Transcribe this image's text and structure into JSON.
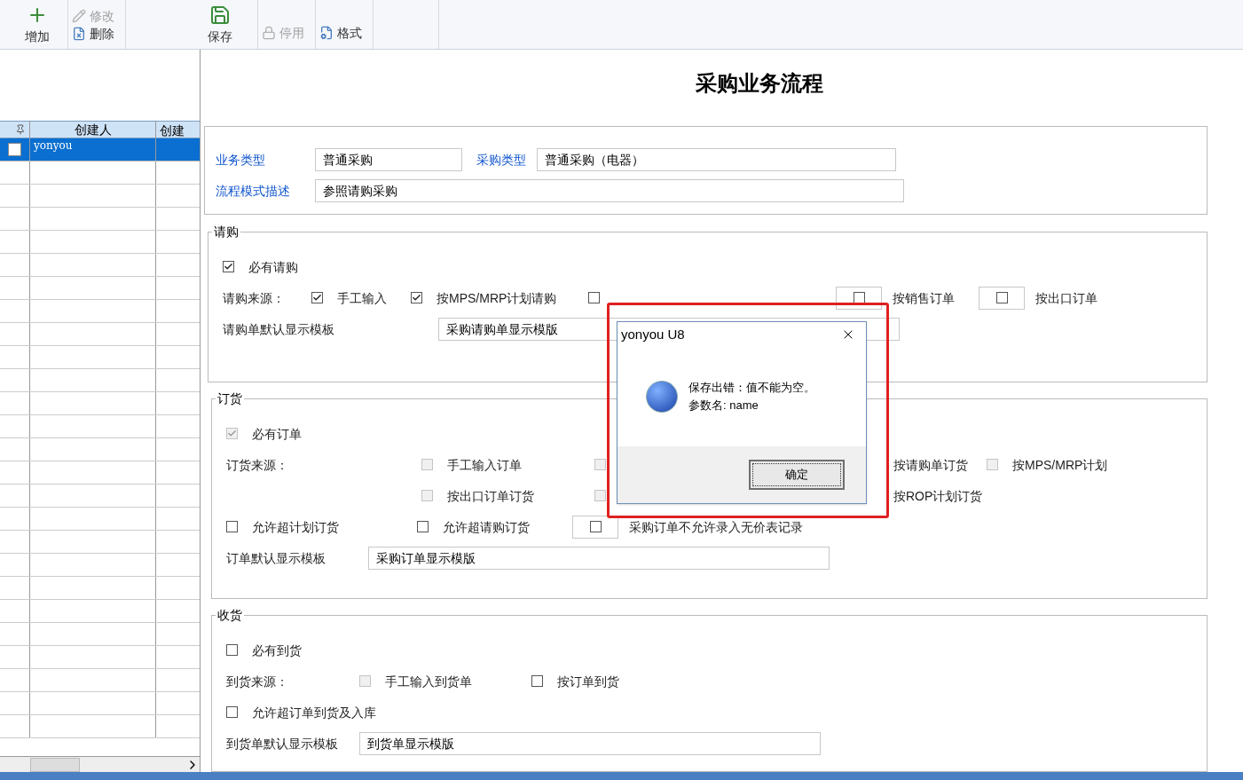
{
  "toolbar": {
    "groups": [
      {
        "items": [
          {
            "label": "增加",
            "kind": "large",
            "disabled": false
          }
        ]
      },
      {
        "items": [
          {
            "label": "修改",
            "kind": "small",
            "disabled": true
          },
          {
            "label": "删除",
            "kind": "small",
            "disabled": false
          }
        ]
      },
      {
        "items": [
          {
            "label": "保存",
            "kind": "large",
            "disabled": false
          }
        ]
      },
      {
        "items": [
          {
            "label": "停用",
            "kind": "small",
            "disabled": true
          }
        ]
      },
      {
        "items": [
          {
            "label": "格式",
            "kind": "small",
            "disabled": false
          }
        ]
      }
    ]
  },
  "page_title": "采购业务流程",
  "grid": {
    "columns": [
      "创建人",
      "创建"
    ],
    "rows": [
      {
        "selected": true,
        "checked": false,
        "cells": [
          "yonyou"
        ]
      }
    ]
  },
  "header": {
    "fields": [
      {
        "label": "业务类型",
        "value": "普通采购"
      },
      {
        "label": "采购类型",
        "value": "普通采购（电器）"
      },
      {
        "label": "流程模式描述",
        "value": "参照请购采购"
      }
    ]
  },
  "sections": [
    {
      "title": "请购",
      "rows": [
        [
          {
            "kind": "checkbox",
            "label": "必有请购",
            "checked": true,
            "disabled": false
          }
        ],
        [
          {
            "kind": "text",
            "label": "请购来源："
          },
          {
            "kind": "checkbox",
            "label": "手工输入",
            "checked": true,
            "disabled": false
          },
          {
            "kind": "checkbox",
            "label": "按MPS/MRP计划请购",
            "checked": true,
            "disabled": false
          },
          {
            "kind": "checkbox",
            "checked": false,
            "disabled": false
          },
          {
            "kind": "boxed",
            "label": "按销售订单",
            "checked": false,
            "disabled": false
          },
          {
            "kind": "boxed",
            "label": "按出口订单",
            "checked": false,
            "disabled": false
          }
        ],
        [
          {
            "kind": "text",
            "label": "请购单默认显示模板"
          },
          {
            "kind": "blank"
          },
          {
            "kind": "field",
            "value": "采购请购单显示模版"
          }
        ]
      ]
    },
    {
      "title": "订货",
      "rows": [
        [
          {
            "kind": "checkbox",
            "label": "必有订单",
            "checked": true,
            "disabled": true
          }
        ],
        [
          {
            "kind": "text",
            "label": "订货来源："
          },
          {
            "kind": "checkbox",
            "label": "手工输入订单",
            "checked": false,
            "disabled": true
          },
          {
            "kind": "checkbox",
            "checked": false,
            "disabled": true
          },
          {
            "kind": "text",
            "label": "按请购单订货"
          },
          {
            "kind": "checkbox",
            "label": "按MPS/MRP计划",
            "checked": false,
            "disabled": true
          }
        ],
        [
          {
            "kind": "blank"
          },
          {
            "kind": "checkbox",
            "label": "按出口订单订货",
            "checked": false,
            "disabled": true
          },
          {
            "kind": "checkbox",
            "checked": false,
            "disabled": true
          },
          {
            "kind": "text",
            "label": "按ROP计划订货"
          }
        ],
        [
          {
            "kind": "checkbox",
            "label": "允许超计划订货",
            "checked": false,
            "disabled": false
          },
          {
            "kind": "checkbox",
            "label": "允许超请购订货",
            "checked": false,
            "disabled": false
          },
          {
            "kind": "boxed",
            "label": "采购订单不允许录入无价表记录",
            "checked": false,
            "disabled": false
          }
        ],
        [
          {
            "kind": "text",
            "label": "订单默认显示模板"
          },
          {
            "kind": "field",
            "value": "采购订单显示模版"
          }
        ]
      ]
    },
    {
      "title": "收货",
      "rows": [
        [
          {
            "kind": "checkbox",
            "label": "必有到货",
            "checked": false,
            "disabled": false
          }
        ],
        [
          {
            "kind": "text",
            "label": "到货来源："
          },
          {
            "kind": "checkbox",
            "label": "手工输入到货单",
            "checked": false,
            "disabled": true
          },
          {
            "kind": "checkbox",
            "label": "按订单到货",
            "checked": false,
            "disabled": false
          }
        ],
        [
          {
            "kind": "checkbox",
            "label": "允许超订单到货及入库",
            "checked": false,
            "disabled": false
          }
        ],
        [
          {
            "kind": "text",
            "label": "到货单默认显示模板"
          },
          {
            "kind": "field",
            "value": "到货单显示模版"
          }
        ]
      ]
    }
  ],
  "dialog": {
    "title": "yonyou U8",
    "lines": [
      "保存出错：值不能为空。",
      "参数名: name"
    ],
    "button": "确定"
  }
}
